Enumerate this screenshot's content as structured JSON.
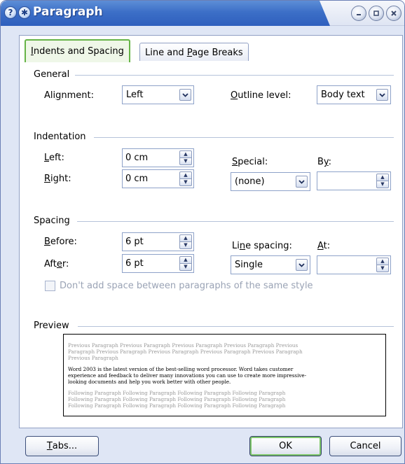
{
  "window": {
    "title": "Paragraph",
    "help_glyph": "?",
    "pin_glyph": "✱"
  },
  "tabs": [
    {
      "label_pre": "",
      "label_key": "I",
      "label_post": "ndents and Spacing",
      "active": true
    },
    {
      "label_pre": "Line and ",
      "label_key": "P",
      "label_post": "age Breaks",
      "active": false
    }
  ],
  "general": {
    "section_label": "General",
    "alignment_label_pre": "Ali",
    "alignment_label_key": "g",
    "alignment_label_post": "nment:",
    "alignment_value": "Left",
    "outline_label_pre": "",
    "outline_label_key": "O",
    "outline_label_post": "utline level:",
    "outline_value": "Body text"
  },
  "indentation": {
    "section_label": "Indentation",
    "left_label_key": "L",
    "left_label_post": "eft:",
    "left_value": "0 cm",
    "right_label_key": "R",
    "right_label_post": "ight:",
    "right_value": "0 cm",
    "special_label_key": "S",
    "special_label_post": "pecial:",
    "special_value": "(none)",
    "by_label_pre": "B",
    "by_label_key": "y",
    "by_label_post": ":",
    "by_value": ""
  },
  "spacing": {
    "section_label": "Spacing",
    "before_label_key": "B",
    "before_label_post": "efore:",
    "before_value": "6 pt",
    "after_label_pre": "Aft",
    "after_label_key": "e",
    "after_label_post": "r:",
    "after_value": "6 pt",
    "line_spacing_label_pre": "Li",
    "line_spacing_label_key": "n",
    "line_spacing_label_post": "e spacing:",
    "line_spacing_value": "Single",
    "at_label_key": "A",
    "at_label_post": "t:",
    "at_value": "",
    "dont_add_space_label": "Don't add space between paragraphs of the same style",
    "dont_add_space_checked": false
  },
  "preview": {
    "section_label": "Preview",
    "prev_lines": [
      "Previous Paragraph Previous Paragraph Previous Paragraph Previous Paragraph Previous",
      "Paragraph Previous Paragraph Previous Paragraph Previous Paragraph Previous Paragraph",
      "Previous Paragraph"
    ],
    "sample_lines": [
      "Word 2003 is the latest version of the best-selling word processor. Word takes customer",
      "experience and feedback to deliver many innovations you can use to create more impressive-",
      "looking documents and help you work better with other people."
    ],
    "next_lines": [
      "Following Paragraph Following Paragraph Following Paragraph Following Paragraph",
      "Following Paragraph Following Paragraph Following Paragraph Following Paragraph",
      "Following Paragraph Following Paragraph Following Paragraph Following Paragraph"
    ]
  },
  "buttons": {
    "tabs_key": "T",
    "tabs_post": "abs...",
    "ok": "OK",
    "cancel": "Cancel"
  },
  "icons": {
    "combo_arrow": "dropdown-arrow-icon",
    "spin_up": "spin-up-icon",
    "spin_down": "spin-down-icon"
  },
  "colors": {
    "title_blue": "#3c6fc7",
    "active_tab_accent": "#66b447",
    "frame_bg": "#dfe6f5"
  }
}
